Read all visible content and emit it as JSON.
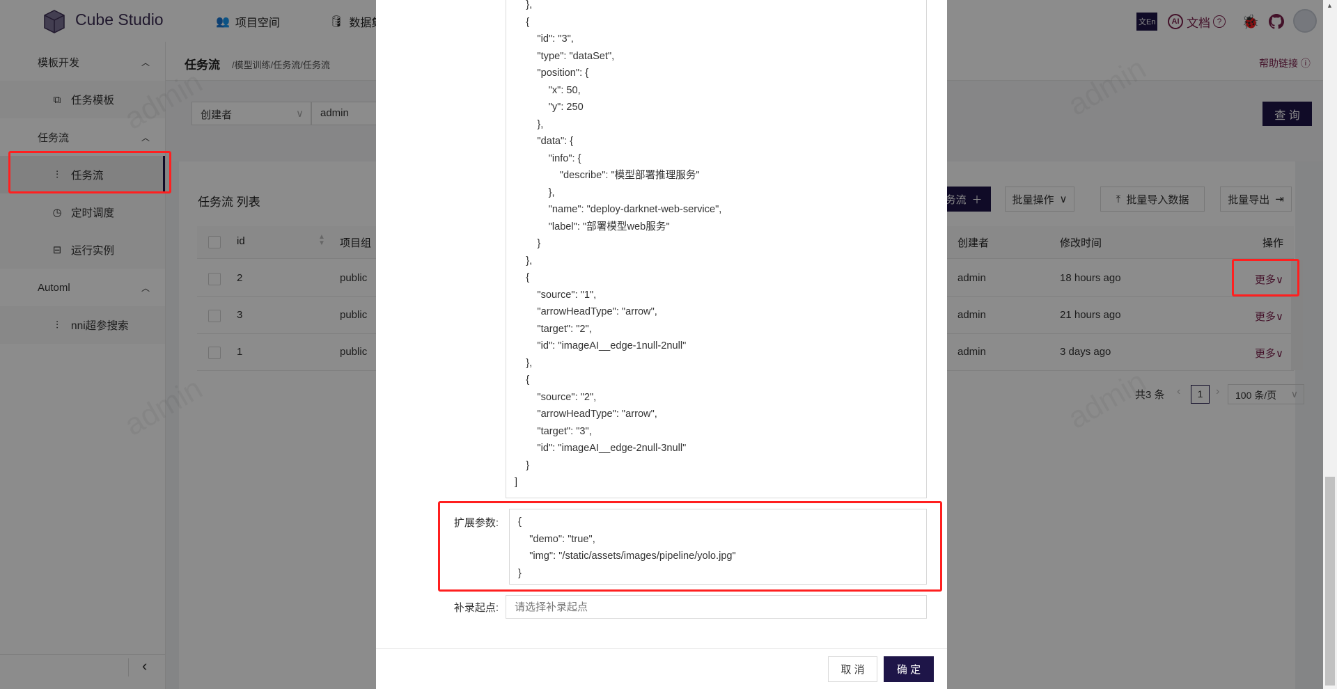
{
  "header": {
    "app_name": "Cube Studio",
    "nav": [
      {
        "label": "项目空间",
        "icon": "team-icon"
      },
      {
        "label": "数据集",
        "icon": "database-icon"
      }
    ],
    "right": {
      "translate_icon": "文En",
      "ai_label": "AI",
      "docs_label": "文档",
      "help_icon": "?"
    }
  },
  "sidebar": {
    "groups": [
      {
        "label": "模板开发",
        "items": [
          {
            "label": "任务模板",
            "icon": "puzzle-icon"
          }
        ]
      },
      {
        "label": "任务流",
        "items": [
          {
            "label": "任务流",
            "icon": "sliders-icon",
            "active": true
          },
          {
            "label": "定时调度",
            "icon": "clock-icon"
          },
          {
            "label": "运行实例",
            "icon": "instance-icon"
          }
        ]
      },
      {
        "label": "Automl",
        "items": [
          {
            "label": "nni超参搜索",
            "icon": "sliders-icon"
          }
        ]
      }
    ],
    "collapse_icon": "‹"
  },
  "page": {
    "title": "任务流",
    "breadcrumb": "/模型训练/任务流/任务流",
    "help_link": "帮助链接"
  },
  "filter": {
    "field": "创建者",
    "value": "admin",
    "query_button": "查 询"
  },
  "list": {
    "title": "任务流 列表",
    "add_button": "添加任务流",
    "batch_ops": "批量操作",
    "batch_import": "批量导入数据",
    "batch_export": "批量导出",
    "columns": [
      "id",
      "项目组",
      "创建者",
      "修改时间",
      "操作"
    ],
    "rows": [
      {
        "id": "2",
        "project": "public",
        "creator": "admin",
        "modified": "18 hours ago",
        "action": "更多"
      },
      {
        "id": "3",
        "project": "public",
        "creator": "admin",
        "modified": "21 hours ago",
        "action": "更多"
      },
      {
        "id": "1",
        "project": "public",
        "creator": "admin",
        "modified": "3 days ago",
        "action": "更多"
      }
    ],
    "pagination": {
      "total": "共3 条",
      "current": "1",
      "page_size": "100 条/页"
    }
  },
  "watermark": "admin",
  "modal": {
    "dag_json": "    },\n    {\n        \"id\": \"3\",\n        \"type\": \"dataSet\",\n        \"position\": {\n            \"x\": 50,\n            \"y\": 250\n        },\n        \"data\": {\n            \"info\": {\n                \"describe\": \"模型部署推理服务\"\n            },\n            \"name\": \"deploy-darknet-web-service\",\n            \"label\": \"部署模型web服务\"\n        }\n    },\n    {\n        \"source\": \"1\",\n        \"arrowHeadType\": \"arrow\",\n        \"target\": \"2\",\n        \"id\": \"imageAI__edge-1null-2null\"\n    },\n    {\n        \"source\": \"2\",\n        \"arrowHeadType\": \"arrow\",\n        \"target\": \"3\",\n        \"id\": \"imageAI__edge-2null-3null\"\n    }\n]",
    "expand_label": "扩展参数:",
    "expand_value": "{\n    \"demo\": \"true\",\n    \"img\": \"/static/assets/images/pipeline/yolo.jpg\"\n}",
    "backfill_label": "补录起点:",
    "backfill_placeholder": "请选择补录起点",
    "cancel": "取 消",
    "ok": "确 定"
  },
  "colors": {
    "primary": "#1e1548",
    "link": "#7a1f4b",
    "highlight": "#ff1f1f"
  }
}
